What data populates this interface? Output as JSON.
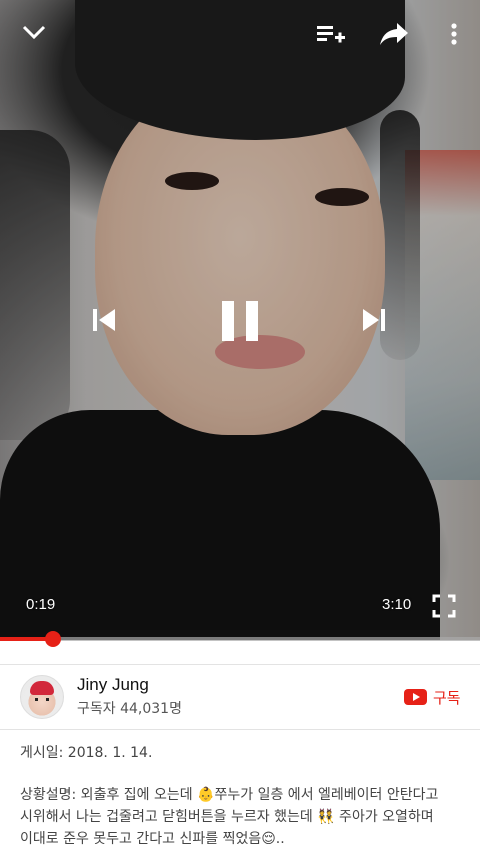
{
  "player": {
    "elapsed": "0:19",
    "total": "3:10",
    "progress_fraction": 0.11
  },
  "icons": {
    "minimize": "chevron-down-icon",
    "queue": "add-to-queue-icon",
    "share": "share-icon",
    "more": "more-vertical-icon",
    "previous": "skip-previous-icon",
    "pause": "pause-icon",
    "next": "skip-next-icon",
    "fullscreen": "fullscreen-icon",
    "subscribe": "youtube-logo-icon"
  },
  "channel": {
    "name": "Jiny Jung",
    "subscribers": "구독자 44,031명",
    "subscribe_label": "구독"
  },
  "description": {
    "date": "게시일: 2018. 1. 14.",
    "text": "상황설명: 외출후 집에 오는데 👶쭈누가 일층 에서 엘레베이터 안탄다고 시위해서 나는 겁줄려고 닫힘버튼을 누르자 했는데 👯 주아가 오열하며 이대로 준우 못두고 간다고 신파를 찍었음😌.."
  },
  "colors": {
    "accent": "#e62117",
    "text_primary": "#111111",
    "text_secondary": "#555555"
  }
}
